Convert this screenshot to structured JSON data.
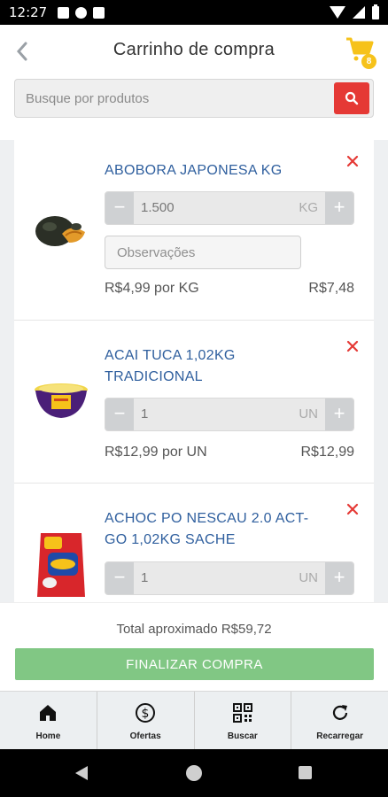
{
  "status_bar": {
    "time": "12:27"
  },
  "header": {
    "title": "Carrinho de compra",
    "cart_count": "8"
  },
  "search": {
    "placeholder": "Busque por produtos"
  },
  "items": [
    {
      "name": "ABOBORA JAPONESA KG",
      "quantity": "1.500",
      "unit": "KG",
      "obs_placeholder": "Observações",
      "price": "R$4,99 por KG",
      "subtotal": "R$7,48"
    },
    {
      "name": "ACAI TUCA 1,02KG TRADICIONAL",
      "quantity": "1",
      "unit": "UN",
      "price": "R$12,99 por UN",
      "subtotal": "R$12,99"
    },
    {
      "name": "ACHOC PO NESCAU 2.0 ACT-GO 1,02KG SACHE",
      "quantity": "1",
      "unit": "UN"
    }
  ],
  "footer": {
    "total": "Total aproximado R$59,72",
    "checkout_label": "FINALIZAR COMPRA"
  },
  "bottom_nav": [
    {
      "label": "Home",
      "icon": "home-icon"
    },
    {
      "label": "Ofertas",
      "icon": "dollar-icon"
    },
    {
      "label": "Buscar",
      "icon": "qr-code-icon"
    },
    {
      "label": "Recarregar",
      "icon": "refresh-icon"
    }
  ],
  "colors": {
    "accent_red": "#e53935",
    "checkout_green": "#81c784",
    "cart_yellow": "#f6c21a",
    "product_blue": "#2f5f9e"
  }
}
